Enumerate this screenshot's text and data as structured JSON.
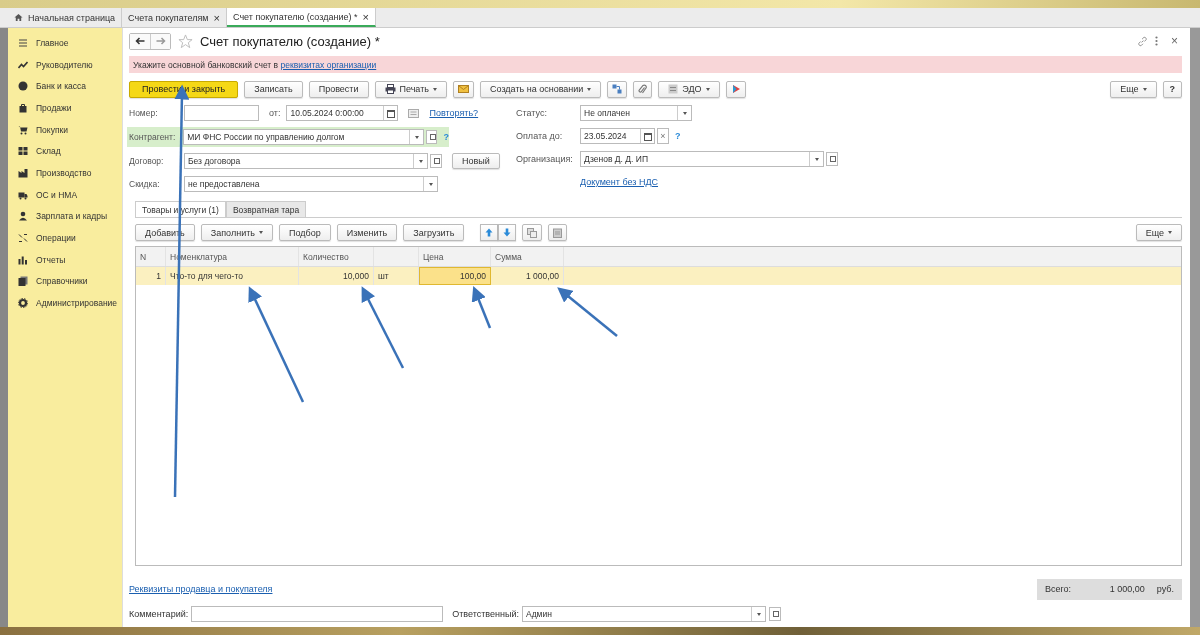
{
  "tabs": [
    {
      "label": "Начальная страница",
      "selected": false
    },
    {
      "label": "Счета покупателям",
      "selected": false,
      "close": "×"
    },
    {
      "label": "Счет покупателю (создание) *",
      "selected": true,
      "close": "×"
    }
  ],
  "sidebar": {
    "items": [
      {
        "label": "Главное"
      },
      {
        "label": "Руководителю"
      },
      {
        "label": "Банк и касса"
      },
      {
        "label": "Продажи"
      },
      {
        "label": "Покупки"
      },
      {
        "label": "Склад"
      },
      {
        "label": "Производство"
      },
      {
        "label": "ОС и НМА"
      },
      {
        "label": "Зарплата и кадры"
      },
      {
        "label": "Операции"
      },
      {
        "label": "Отчеты"
      },
      {
        "label": "Справочники"
      },
      {
        "label": "Администрирование"
      }
    ]
  },
  "document": {
    "title": "Счет покупателю (создание) *",
    "close": "×",
    "warning": {
      "text": "Укажите основной банковский счет в",
      "link": "реквизитах организации"
    },
    "toolbar": [
      {
        "kind": "primary",
        "label": "Провести и закрыть"
      },
      {
        "kind": "plain",
        "label": "Записать"
      },
      {
        "kind": "plain",
        "label": "Провести"
      },
      {
        "kind": "menu",
        "label": "Печать"
      },
      {
        "kind": "icon"
      },
      {
        "kind": "menu",
        "label": "Создать на основании"
      },
      {
        "kind": "icon"
      },
      {
        "kind": "icon"
      },
      {
        "kind": "menu",
        "label": "ЭДО"
      },
      {
        "kind": "icon"
      }
    ],
    "more_button": "Еще",
    "help_button": "?",
    "number": {
      "label": "Номер:"
    },
    "date": {
      "label": "от:",
      "value": "10.05.2024  0:00:00"
    },
    "repeat_link": "Повторять?",
    "counterparty": {
      "label": "Контрагент:",
      "value": "МИ ФНС России по управлению долгом",
      "help": "?"
    },
    "contract": {
      "label": "Договор:",
      "value": "Без договора",
      "button": "Новый"
    },
    "discount": {
      "label": "Скидка:",
      "value": "не предоставлена"
    },
    "status": {
      "label": "Статус:",
      "value": "Не оплачен"
    },
    "pay_by": {
      "label": "Оплата до:",
      "value": "23.05.2024",
      "clear": "×",
      "help": "?"
    },
    "organization": {
      "label": "Организация:",
      "value": "Дзенов Д. Д. ИП"
    },
    "vat_link": "Документ без НДС",
    "subtabs": [
      {
        "label": "Товары и услуги (1)",
        "selected": true
      },
      {
        "label": "Возвратная тара",
        "selected": false
      }
    ],
    "table_toolbar": [
      {
        "kind": "plain",
        "label": "Добавить"
      },
      {
        "kind": "menu",
        "label": "Заполнить"
      },
      {
        "kind": "plain",
        "label": "Подбор"
      },
      {
        "kind": "plain",
        "label": "Изменить"
      },
      {
        "kind": "plain",
        "label": "Загрузить"
      }
    ],
    "table_more": "Еще",
    "table": {
      "columns": [
        "N",
        "Номенклатура",
        "Количество",
        "",
        "Цена",
        "Сумма"
      ],
      "rows": [
        {
          "cells": [
            {
              "text": "1",
              "active": false
            },
            {
              "text": "Что-то для чего-то",
              "active": false
            },
            {
              "text": "10,000",
              "active": false
            },
            {
              "text": "шт",
              "active": false
            },
            {
              "text": "100,00",
              "active": true
            },
            {
              "text": "1 000,00",
              "active": false
            }
          ],
          "selected": true
        }
      ]
    },
    "details_link": "Реквизиты продавца и покупателя",
    "total": {
      "label": "Всего:",
      "value": "1 000,00",
      "currency": "руб."
    },
    "comment": {
      "label": "Комментарий:"
    },
    "responsible": {
      "label": "Ответственный:",
      "value": "Админ"
    }
  }
}
